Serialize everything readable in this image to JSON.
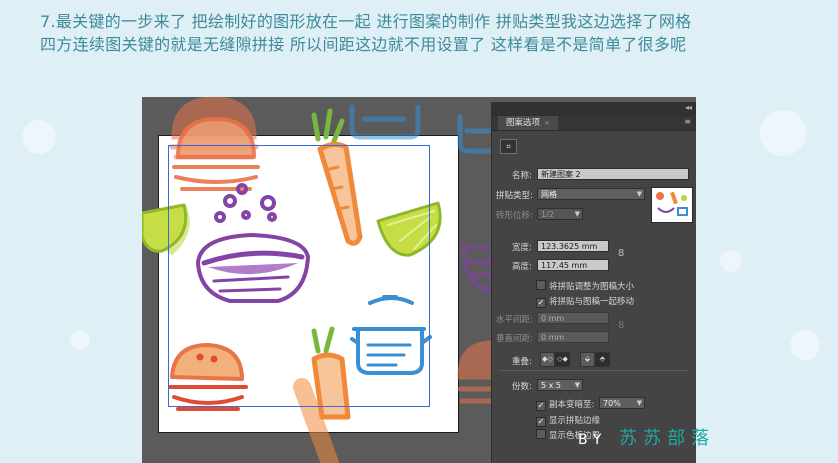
{
  "caption": {
    "line1": "7.最关键的一步来了 把绘制好的图形放在一起 进行图案的制作 拼贴类型我这边选择了网格",
    "line2": "四方连续图关键的就是无缝隙拼接 所以间距这边就不用设置了 这样看是不是简单了很多呢"
  },
  "panel": {
    "tab_label": "图案选项",
    "tab_close": "×",
    "menu_icon": "≡",
    "collapse_icon": "◂◂",
    "tile_tool_glyph": "⌗",
    "name_label": "名称:",
    "name_value": "新建图案 2",
    "tile_type_label": "拼贴类型:",
    "tile_type_value": "网格",
    "brick_offset_label": "砖形位移:",
    "brick_offset_value": "1/2",
    "width_label": "宽度:",
    "width_value": "123.3625 mm",
    "height_label": "高度:",
    "height_value": "117.45 mm",
    "link_glyph": "8",
    "size_tile_to_art": "将拼贴调整为图稿大小",
    "move_tile_with_art": "将拼贴与图稿一起移动",
    "h_spacing_label": "水平间距:",
    "h_spacing_value": "0 mm",
    "v_spacing_label": "垂直间距:",
    "v_spacing_value": "0 mm",
    "overlap_label": "重叠:",
    "overlap_btns": [
      "◆◇",
      "◇◆",
      "⬙",
      "⬘"
    ],
    "copies_label": "份数:",
    "copies_value": "5 x 5",
    "dim_copies_label": "副本变暗至:",
    "dim_copies_value": "70%",
    "show_tile_edge": "显示拼贴边缘",
    "show_swatch_bounds": "显示色板边界",
    "check_mark": "✓"
  },
  "brand": {
    "prefix": "BY",
    "name": "苏苏部落"
  },
  "colors": {
    "caption": "#3e8a9b",
    "brand_prefix": "#ffffff",
    "brand_name": "#23a7a0",
    "burger": "#e8744a",
    "carrot": "#f08a3a",
    "carrot_leaf": "#79b73e",
    "lime": "#b9d43a",
    "bowl": "#8443a6",
    "pot": "#3a8fd3",
    "burger_red": "#e04b36"
  }
}
